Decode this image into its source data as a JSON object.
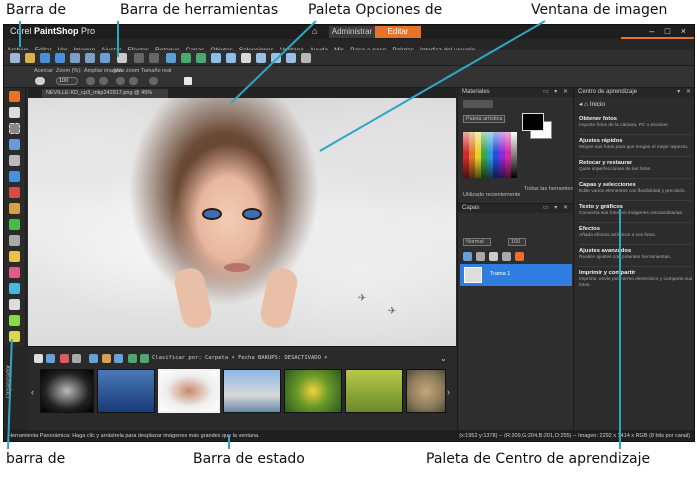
{
  "callouts": {
    "barra_de_menus": "Barra de",
    "barra_herramientas": "Barra de herramientas",
    "paleta_opciones": "Paleta Opciones de",
    "ventana_imagen": "Ventana de imagen",
    "barra_de_tools": "barra de",
    "barra_estado": "Barra de estado",
    "paleta_centro": "Paleta de Centro de aprendizaje"
  },
  "app": {
    "title_prefix": "Corel",
    "title_main": "PaintShop",
    "title_suffix": "Pro",
    "modes": [
      "Administrar",
      "Editar"
    ],
    "active_mode": "Editar",
    "accent_color": "#e5742a",
    "window_controls": "– □ ×"
  },
  "menu": [
    "Archivo",
    "Editar",
    "Ver",
    "Imagen",
    "Ajustar",
    "Efectos",
    "Retoque",
    "Capas",
    "Objetos",
    "Selecciones",
    "Ventana",
    "Ayuda",
    "Mis",
    "Paso a paso",
    "Paletas",
    "Interfaz del usuario"
  ],
  "options": {
    "labels": [
      "Acercar",
      "Zoom (%):",
      "Ampliar imagen",
      "Más zoom",
      "Tamaño real"
    ],
    "zoom_value": "100"
  },
  "document_tab": "NEVILLE-KD_cp3_mkp242917.png @ 45%",
  "organizer": {
    "label": "Organizador",
    "sort_text": "Clasificar por:    Carpeta ▾  Fecha BAKUPS: DESACTIVADO ▾",
    "thumb_count_shown": 8
  },
  "status": {
    "left": "Herramienta Panorámica: Haga clic y arrástrela para desplazar imágenes más grandes que la ventana.",
    "right": "(x:1952 y:1378) -- (R:209,G:204,B:201,O:255) -- Imagen: 2292 x 1414 x RGB (8 bits por canal)"
  },
  "materials": {
    "title": "Materiales",
    "palette_dropdown": "Paleta artística",
    "recent_label": "Utilizado recientemente",
    "all_tools_label": "Todas las herramientas",
    "fg_color": "#000000",
    "bg_color": "#ffffff"
  },
  "layers": {
    "title": "Capas",
    "blend_mode": "Normal",
    "opacity": "100",
    "layer_name": "Trama 1",
    "highlight_color": "#2f7de0"
  },
  "learning": {
    "title": "Centro de aprendizaje",
    "nav": "Inicio",
    "items": [
      {
        "title": "Obtener fotos",
        "desc": "Importe fotos de la cámara, PC o escáner."
      },
      {
        "title": "Ajustes rápidos",
        "desc": "Mejore sus fotos para que tengan el mejor aspecto."
      },
      {
        "title": "Retocar y restaurar",
        "desc": "Quite imperfecciones de las fotos."
      },
      {
        "title": "Capas y selecciones",
        "desc": "Edite varios elementos con flexibilidad y precisión."
      },
      {
        "title": "Texto y gráficos",
        "desc": "Convierta sus fotos en imágenes extraordinarias."
      },
      {
        "title": "Efectos",
        "desc": "Añada efectos artísticos a sus fotos."
      },
      {
        "title": "Ajustes avanzados",
        "desc": "Realice ajustes con potentes herramientas."
      },
      {
        "title": "Imprimir y compartir",
        "desc": "Imprima, envíe por correo electrónico y comparta sus fotos."
      }
    ]
  },
  "icons": {
    "home": "home-icon",
    "leader_color": "#2fa6c6"
  }
}
